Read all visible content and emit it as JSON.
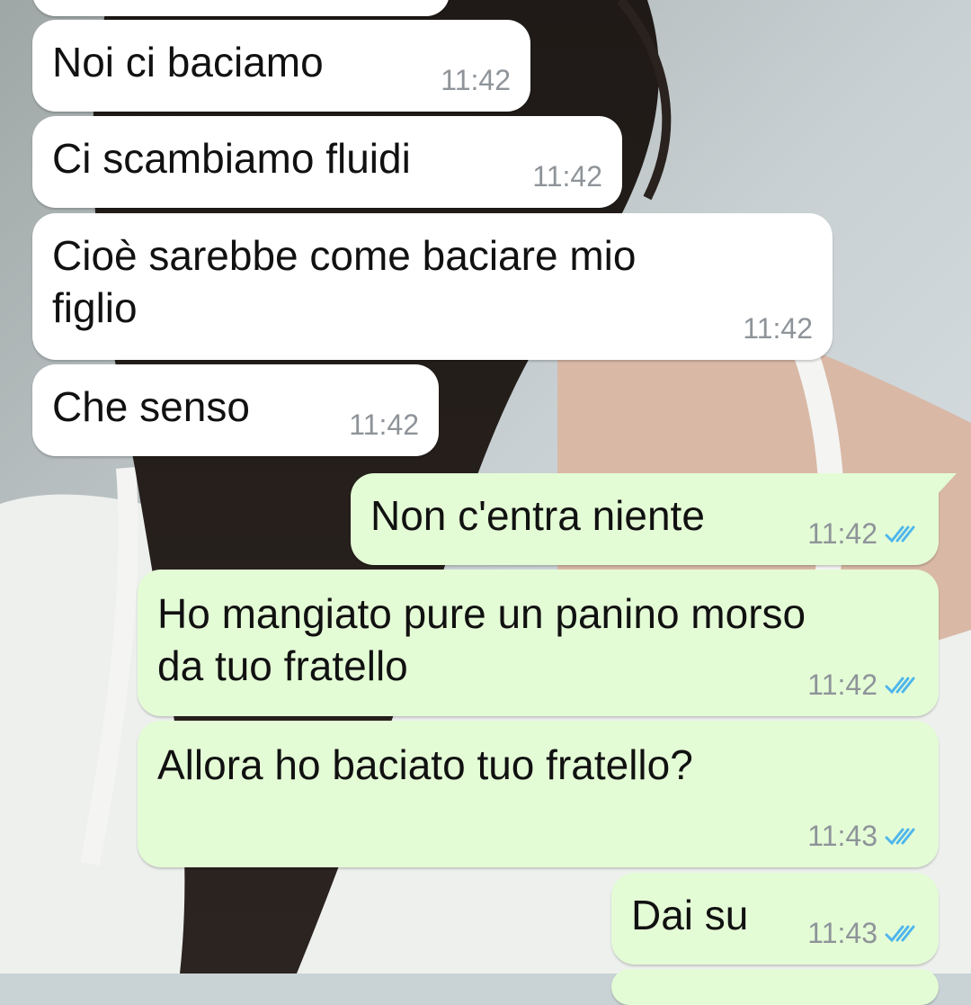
{
  "chat": {
    "messages": [
      {
        "direction": "in",
        "text": "Noi ci baciamo",
        "time": "11:42"
      },
      {
        "direction": "in",
        "text": "Ci scambiamo fluidi",
        "time": "11:42"
      },
      {
        "direction": "in",
        "text": "Cioè sarebbe come baciare mio\nfiglio",
        "time": "11:42"
      },
      {
        "direction": "in",
        "text": "Che senso",
        "time": "11:42"
      },
      {
        "direction": "out",
        "text": "Non c'entra niente",
        "time": "11:42",
        "status": "read"
      },
      {
        "direction": "out",
        "text": "Ho mangiato pure un panino morso\nda tuo fratello",
        "time": "11:42",
        "status": "read"
      },
      {
        "direction": "out",
        "text": "Allora ho baciato tuo fratello?",
        "time": "11:43",
        "status": "read"
      },
      {
        "direction": "out",
        "text": "Dai su",
        "time": "11:43",
        "status": "read"
      }
    ]
  },
  "colors": {
    "incoming_bubble": "#ffffff",
    "outgoing_bubble": "#e4fcd6",
    "read_ticks": "#4fb6ec",
    "timestamp": "#8e9499"
  },
  "icons": {
    "read_status": "double-check-icon"
  }
}
